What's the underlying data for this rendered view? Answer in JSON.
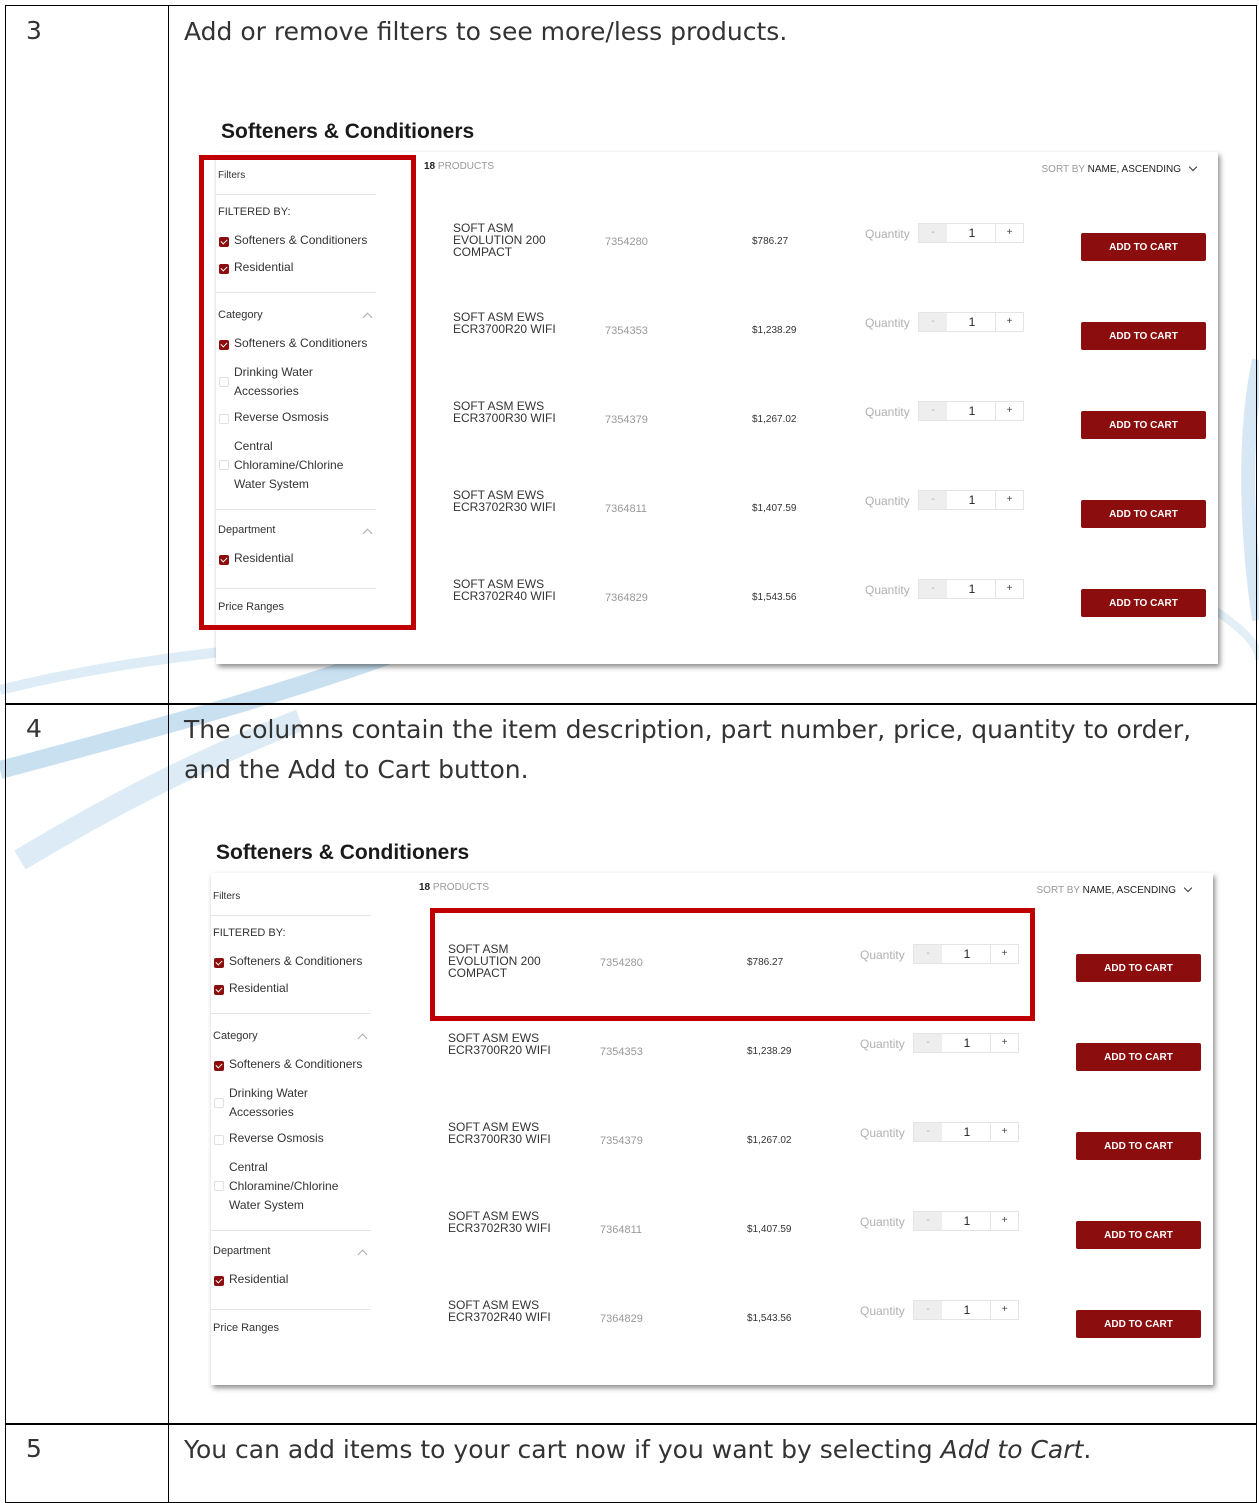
{
  "steps": [
    {
      "number": "3",
      "instruction": "Add or remove filters to see more/less products."
    },
    {
      "number": "4",
      "instruction": "The columns contain the item description, part number, price, quantity to order, and the Add to Cart button."
    },
    {
      "number": "5",
      "instruction_prefix": "You can add items to your cart now if you want by selecting ",
      "instruction_emph": "Add to Cart",
      "instruction_suffix": "."
    }
  ],
  "catalog": {
    "title": "Softeners & Conditioners",
    "filters_heading": "Filters",
    "filtered_by_heading": "FILTERED BY:",
    "filtered_by": [
      "Softeners & Conditioners",
      "Residential"
    ],
    "category_heading": "Category",
    "categories": [
      {
        "label": "Softeners & Conditioners",
        "checked": true
      },
      {
        "label": "Drinking Water Accessories",
        "checked": false
      },
      {
        "label": "Reverse Osmosis",
        "checked": false
      },
      {
        "label": "Central Chloramine/Chlorine Water System",
        "checked": false
      }
    ],
    "department_heading": "Department",
    "departments": [
      {
        "label": "Residential",
        "checked": true
      }
    ],
    "price_ranges_heading": "Price Ranges",
    "product_count": "18",
    "products_label": "PRODUCTS",
    "sort_label": "SORT BY",
    "sort_value": "NAME, ASCENDING",
    "quantity_label": "Quantity",
    "minus_label": "-",
    "plus_label": "+",
    "add_to_cart_label": "ADD TO CART",
    "products": [
      {
        "desc_lines": [
          "SOFT ASM",
          "EVOLUTION 200",
          "COMPACT"
        ],
        "part": "7354280",
        "price": "$786.27",
        "qty": "1"
      },
      {
        "desc_lines": [
          "SOFT ASM EWS",
          "ECR3700R20 WIFI"
        ],
        "part": "7354353",
        "price": "$1,238.29",
        "qty": "1"
      },
      {
        "desc_lines": [
          "SOFT ASM EWS",
          "ECR3700R30 WIFI"
        ],
        "part": "7354379",
        "price": "$1,267.02",
        "qty": "1"
      },
      {
        "desc_lines": [
          "SOFT ASM EWS",
          "ECR3702R30 WIFI"
        ],
        "part": "7364811",
        "price": "$1,407.59",
        "qty": "1"
      },
      {
        "desc_lines": [
          "SOFT ASM EWS",
          "ECR3702R40 WIFI"
        ],
        "part": "7364829",
        "price": "$1,543.56",
        "qty": "1"
      }
    ]
  },
  "colors": {
    "accent": "#8b0d0d",
    "highlight": "#c00000",
    "border": "#000000"
  }
}
